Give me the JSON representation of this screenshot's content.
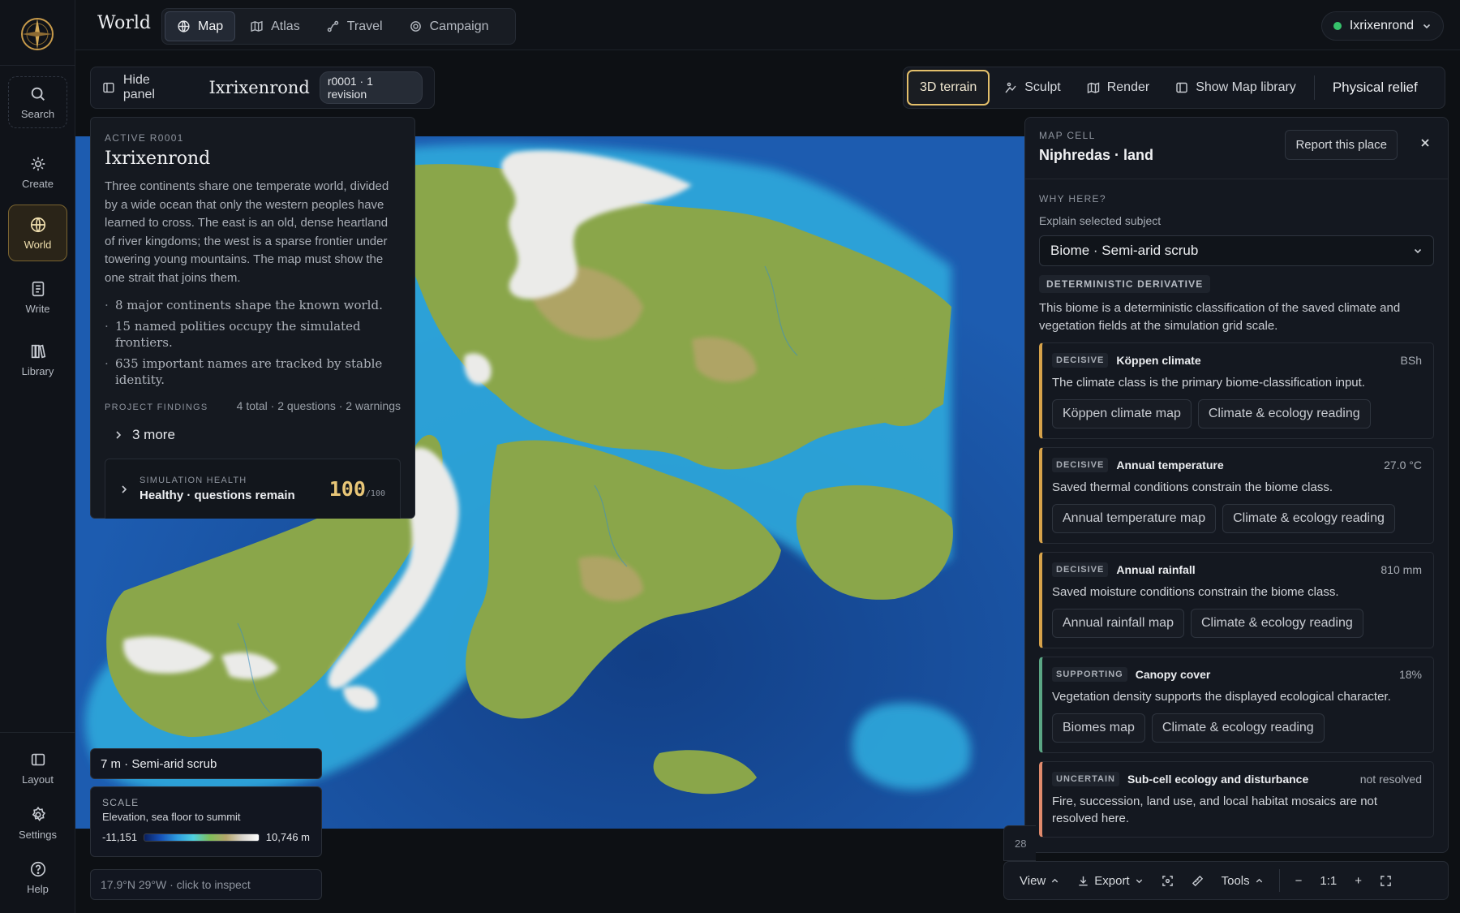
{
  "app": {
    "title": "World"
  },
  "tabs": [
    {
      "label": "Map",
      "icon": "globe-icon",
      "active": true
    },
    {
      "label": "Atlas",
      "icon": "atlas-icon"
    },
    {
      "label": "Travel",
      "icon": "route-icon"
    },
    {
      "label": "Campaign",
      "icon": "target-icon"
    }
  ],
  "user": {
    "name": "Ixrixenrond",
    "status_color": "#36c26b"
  },
  "sidebar": {
    "items": [
      {
        "label": "Search",
        "icon": "search-icon"
      },
      {
        "label": "Create",
        "icon": "sparkle-icon"
      },
      {
        "label": "World",
        "icon": "globe-icon",
        "active": true
      },
      {
        "label": "Write",
        "icon": "document-icon"
      },
      {
        "label": "Library",
        "icon": "library-icon"
      }
    ],
    "bottom": [
      {
        "label": "Layout",
        "icon": "layout-icon"
      },
      {
        "label": "Settings",
        "icon": "gear-icon"
      },
      {
        "label": "Help",
        "icon": "help-icon"
      }
    ]
  },
  "project": {
    "hide_label": "Hide panel",
    "name": "Ixrixenrond",
    "revision": "r0001 · 1 revision"
  },
  "toolbar": {
    "terrain": "3D terrain",
    "sculpt": "Sculpt",
    "render": "Render",
    "library": "Show Map library",
    "relief": "Physical relief"
  },
  "left_panel": {
    "eyebrow": "ACTIVE R0001",
    "title": "Ixrixenrond",
    "description": "Three continents share one temperate world, divided by a wide ocean that only the western peoples have learned to cross. The east is an old, dense heartland of river kingdoms; the west is a sparse frontier under towering young mountains. The map must show the one strait that joins them.",
    "facts": [
      "8 major continents shape the known world.",
      "15 named polities occupy the simulated frontiers.",
      "635 important names are tracked by stable identity."
    ],
    "findings_label": "PROJECT FINDINGS",
    "findings_count": "4 total · 2 questions · 2 warnings",
    "more_label": "3 more",
    "health": {
      "label": "SIMULATION HEALTH",
      "status": "Healthy · questions remain",
      "score": "100",
      "max": "/100"
    }
  },
  "cell_info": "7 m · Semi-arid scrub",
  "scale": {
    "title": "SCALE",
    "subtitle": "Elevation, sea floor to summit",
    "min": "-11,151",
    "max": "10,746 m"
  },
  "coords": "17.9°N 29°W · click to inspect",
  "right_panel": {
    "eyebrow": "MAP CELL",
    "title": "Niphredas · land",
    "report": "Report this place",
    "why": "WHY HERE?",
    "explain": "Explain selected subject",
    "subject": "Biome · Semi-arid scrub",
    "derivative_badge": "DETERMINISTIC DERIVATIVE",
    "derivative_desc": "This biome is a deterministic classification of the saved climate and vegetation fields at the simulation grid scale.",
    "factors": [
      {
        "tag": "DECISIVE",
        "name": "Köppen climate",
        "value": "BSh",
        "desc": "The climate class is the primary biome-classification input.",
        "links": [
          "Köppen climate map",
          "Climate & ecology reading"
        ]
      },
      {
        "tag": "DECISIVE",
        "name": "Annual temperature",
        "value": "27.0 °C",
        "desc": "Saved thermal conditions constrain the biome class.",
        "links": [
          "Annual temperature map",
          "Climate & ecology reading"
        ]
      },
      {
        "tag": "DECISIVE",
        "name": "Annual rainfall",
        "value": "810 mm",
        "desc": "Saved moisture conditions constrain the biome class.",
        "links": [
          "Annual rainfall map",
          "Climate & ecology reading"
        ]
      },
      {
        "tag": "SUPPORTING",
        "name": "Canopy cover",
        "value": "18%",
        "desc": "Vegetation density supports the displayed ecological character.",
        "links": [
          "Biomes map",
          "Climate & ecology reading"
        ]
      },
      {
        "tag": "UNCERTAIN",
        "name": "Sub-cell ecology and disturbance",
        "value": "not resolved",
        "desc": "Fire, succession, land use, and local habitat mosaics are not resolved here.",
        "links": []
      }
    ]
  },
  "bottom_toolbar": {
    "tail": "28",
    "view": "View",
    "export": "Export",
    "tools": "Tools",
    "zoom_out": "−",
    "zoom": "1:1",
    "zoom_in": "+"
  },
  "colors": {
    "accent": "#e3bf6a",
    "decisive": "#d6a24a",
    "supporting": "#5ba684",
    "uncertain": "#e08a6c"
  }
}
